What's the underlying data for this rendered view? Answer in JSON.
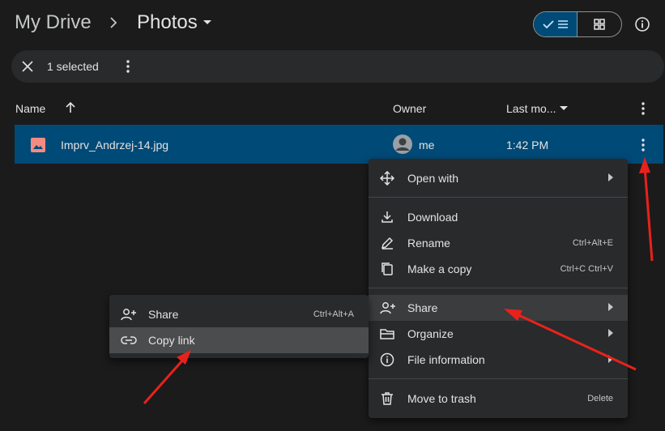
{
  "header": {
    "root_crumb": "My Drive",
    "current_folder": "Photos"
  },
  "selection_bar": {
    "count_label": "1 selected"
  },
  "columns": {
    "name": "Name",
    "owner": "Owner",
    "last_modified": "Last mo..."
  },
  "file": {
    "name": "Imprv_Andrzej-14.jpg",
    "owner": "me",
    "modified": "1:42 PM"
  },
  "context_menu": {
    "open_with": "Open with",
    "download": "Download",
    "rename": "Rename",
    "rename_shortcut": "Ctrl+Alt+E",
    "make_copy": "Make a copy",
    "make_copy_shortcut": "Ctrl+C Ctrl+V",
    "share": "Share",
    "organize": "Organize",
    "file_information": "File information",
    "move_to_trash": "Move to trash",
    "move_to_trash_shortcut": "Delete"
  },
  "share_submenu": {
    "share": "Share",
    "share_shortcut": "Ctrl+Alt+A",
    "copy_link": "Copy link"
  },
  "colors": {
    "background": "#1b1b1b",
    "selected_row": "#004a77",
    "menu": "#282a2c",
    "file_icon": "#f28b82",
    "annotation_arrow": "#e8221b"
  }
}
